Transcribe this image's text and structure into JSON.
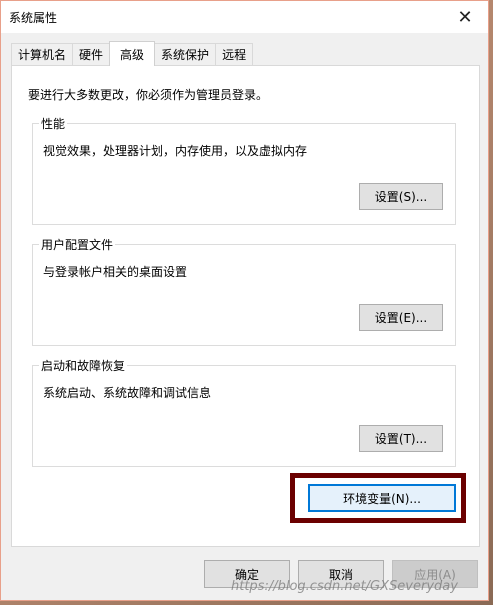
{
  "window": {
    "title": "系统属性"
  },
  "tabs": [
    {
      "label": "计算机名"
    },
    {
      "label": "硬件"
    },
    {
      "label": "高级"
    },
    {
      "label": "系统保护"
    },
    {
      "label": "远程"
    }
  ],
  "admin_note": "要进行大多数更改，你必须作为管理员登录。",
  "performance": {
    "title": "性能",
    "description": "视觉效果，处理器计划，内存使用，以及虚拟内存",
    "button": "设置(S)..."
  },
  "user_profiles": {
    "title": "用户配置文件",
    "description": "与登录帐户相关的桌面设置",
    "button": "设置(E)..."
  },
  "startup_recovery": {
    "title": "启动和故障恢复",
    "description": "系统启动、系统故障和调试信息",
    "button": "设置(T)..."
  },
  "env_button": "环境变量(N)...",
  "footer": {
    "ok": "确定",
    "cancel": "取消",
    "apply": "应用(A)"
  },
  "watermark": "https://blog.csdn.net/GXSeveryday",
  "colors": {
    "highlight_border": "#6b0000",
    "focus_blue": "#0078d7"
  },
  "icons": {
    "close": "close-icon"
  }
}
